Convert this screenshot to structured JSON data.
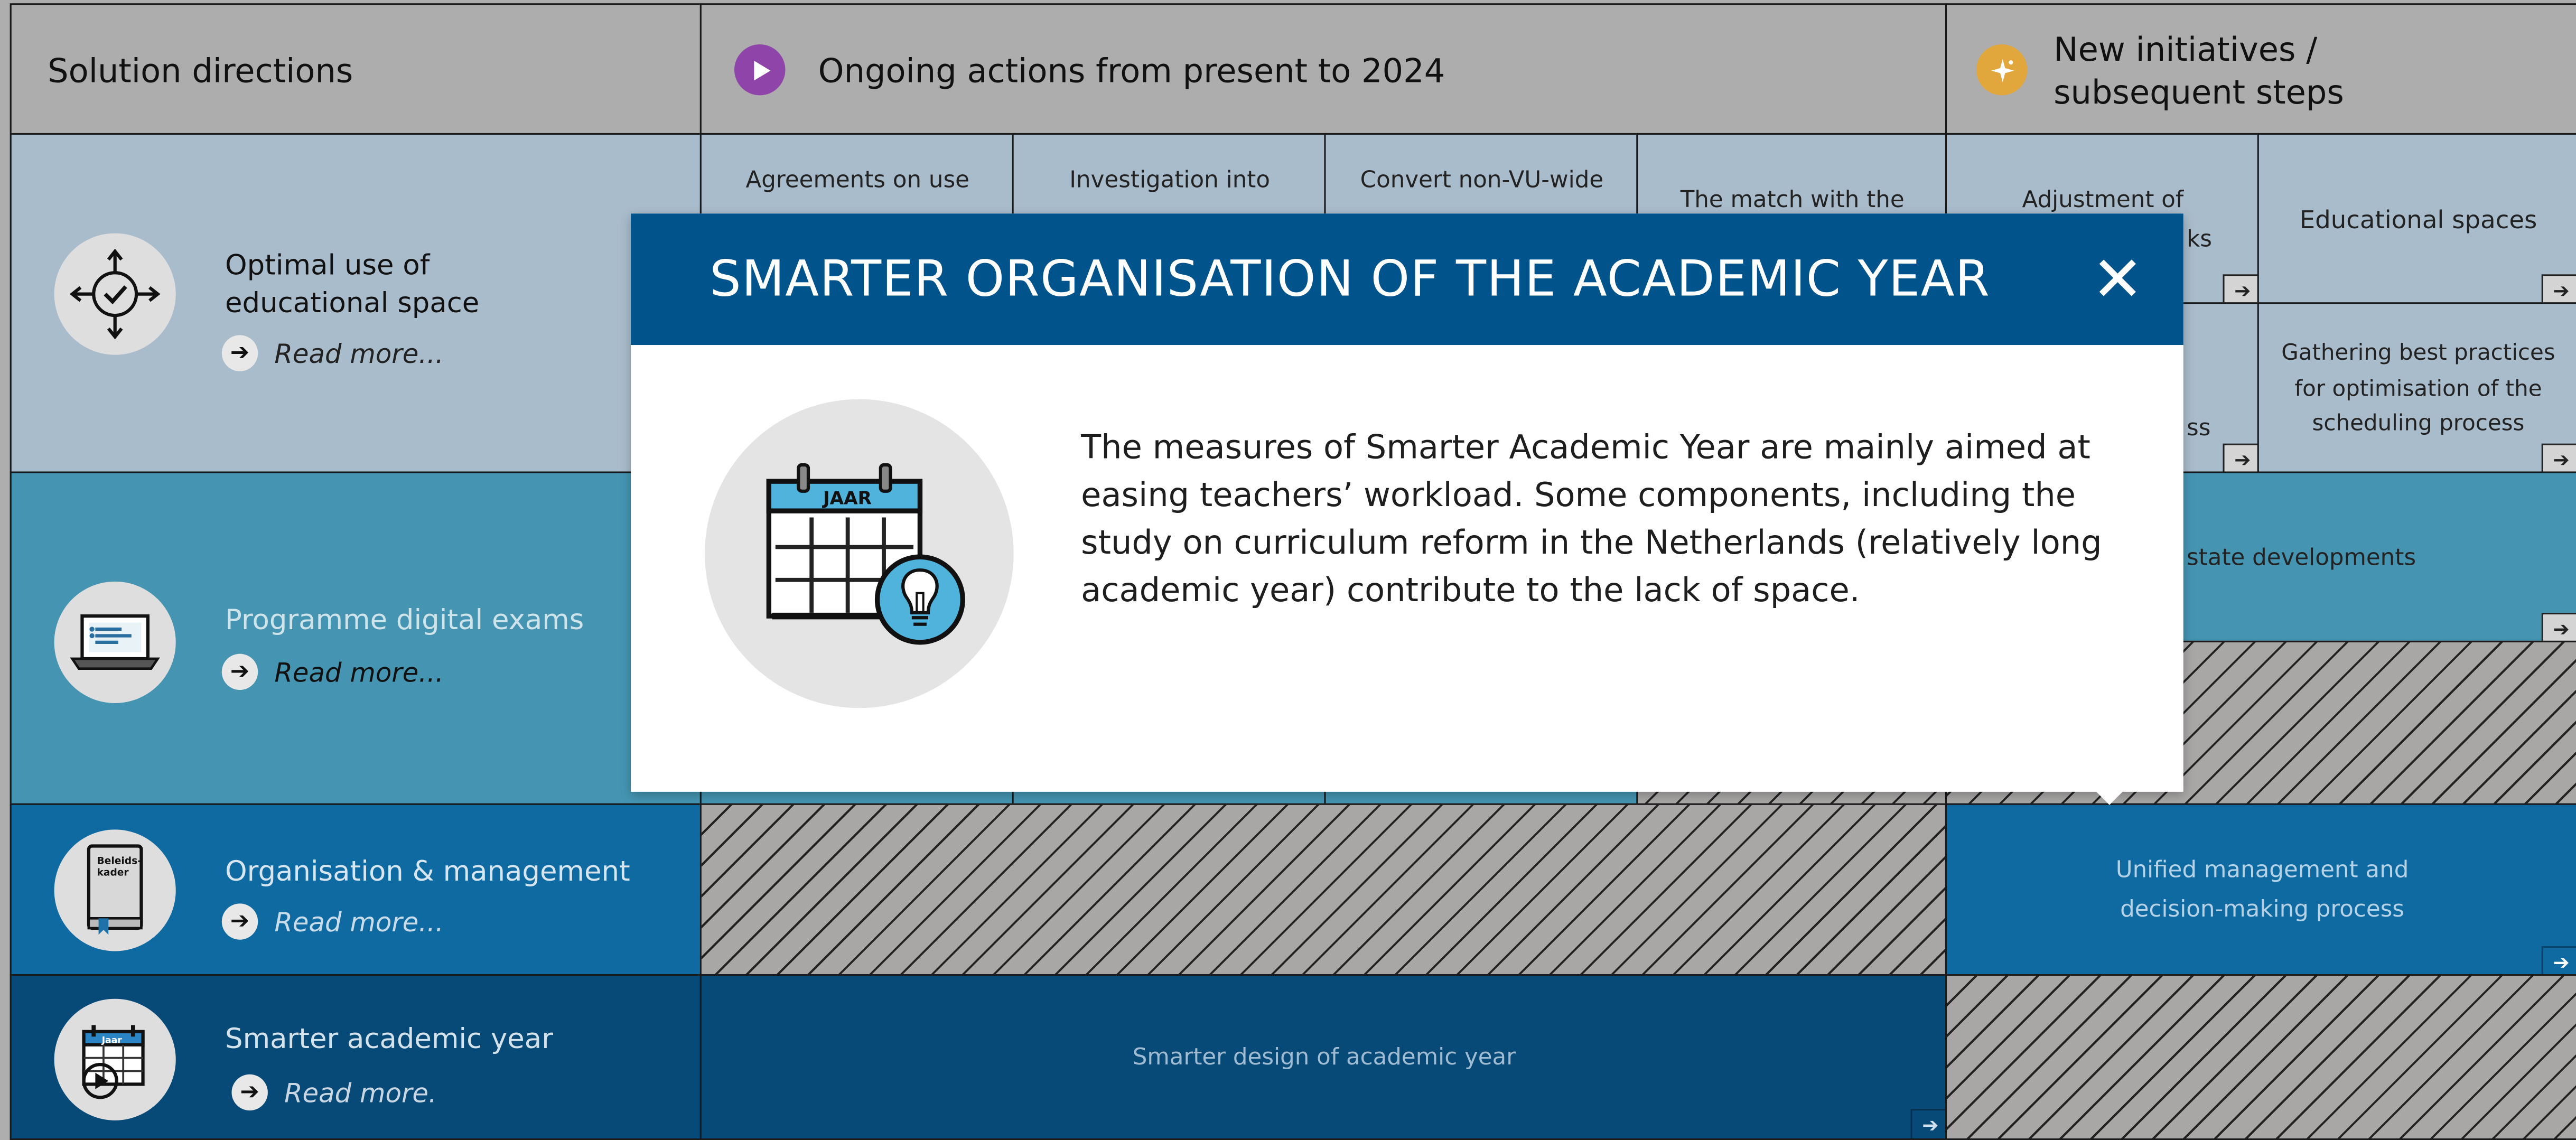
{
  "headers": {
    "solution_directions": "Solution directions",
    "ongoing": "Ongoing actions from present to 2024",
    "new_initiatives_line1": "New initiatives /",
    "new_initiatives_line2": "subsequent steps"
  },
  "rows": {
    "space": {
      "title_line1": "Optimal use of",
      "title_line2": "educational space",
      "read_more": "Read more..."
    },
    "exams": {
      "title": "Programme digital exams",
      "read_more": "Read more..."
    },
    "org": {
      "title": "Organisation & management",
      "read_more": "Read more..."
    },
    "year": {
      "title": "Smarter academic year",
      "read_more": "Read more."
    }
  },
  "cells": {
    "agreements": "Agreements on use",
    "investigation": "Investigation into",
    "convert": "Convert non-VU-wide",
    "match": "The match with the",
    "adjustment": "Adjustment of",
    "adjustment_tail": "ks",
    "educational_spaces": "Educational spaces",
    "process_tail": "ss",
    "best_practices_1": "Gathering best practices",
    "best_practices_2": "for optimisation of the",
    "best_practices_3": "scheduling process",
    "real_estate": "state developments",
    "unified_1": "Unified management and",
    "unified_2": "decision-making process",
    "smarter_design": "Smarter design of academic year"
  },
  "modal": {
    "title": "SMARTER ORGANISATION OF THE ACADEMIC YEAR",
    "body": "The measures of Smarter Academic Year are mainly aimed at easing teachers’ workload. Some components, including the study on curriculum reform in the Netherlands (relatively long academic year) contribute to the lack of space.",
    "icon_label": "JAAR",
    "close_glyph": "✕"
  },
  "icon_labels": {
    "book": "Beleids-kader",
    "calendar_small": "Jaar"
  },
  "colors": {
    "modal_header": "#00538b",
    "row_space": "#a9bccb",
    "row_exams": "#4595b2",
    "row_org": "#0e6aa1",
    "row_year": "#074a78",
    "play_icon": "#8e44a8",
    "sparkle_icon": "#e2a73c"
  }
}
